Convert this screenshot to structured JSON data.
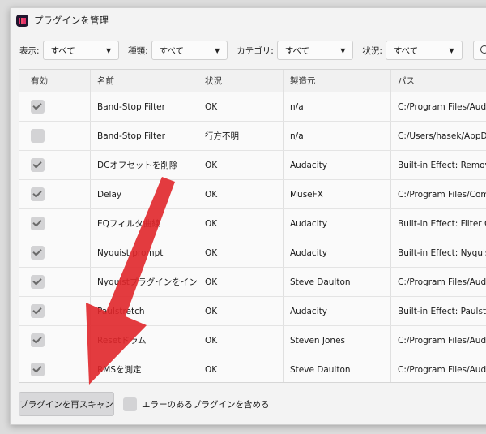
{
  "window": {
    "title": "プラグインを管理"
  },
  "filters": [
    {
      "label": "表示:",
      "value": "すべて"
    },
    {
      "label": "種類:",
      "value": "すべて"
    },
    {
      "label": "カテゴリ:",
      "value": "すべて"
    },
    {
      "label": "状況:",
      "value": "すべて"
    }
  ],
  "table": {
    "headers": [
      "有効",
      "名前",
      "状況",
      "製造元",
      "パス"
    ],
    "rows": [
      {
        "enabled": true,
        "name": "Band-Stop Filter",
        "status": "OK",
        "vendor": "n/a",
        "path": "C:/Program Files/Audac"
      },
      {
        "enabled": false,
        "name": "Band-Stop Filter",
        "status": "行方不明",
        "vendor": "n/a",
        "path": "C:/Users/hasek/AppData"
      },
      {
        "enabled": true,
        "name": "DCオフセットを削除",
        "status": "OK",
        "vendor": "Audacity",
        "path": "Built-in Effect: Remove I"
      },
      {
        "enabled": true,
        "name": "Delay",
        "status": "OK",
        "vendor": "MuseFX",
        "path": "C:/Program Files/Comm"
      },
      {
        "enabled": true,
        "name": "EQフィルタ曲線",
        "status": "OK",
        "vendor": "Audacity",
        "path": "Built-in Effect: Filter Cur"
      },
      {
        "enabled": true,
        "name": "Nyquist prompt",
        "status": "OK",
        "vendor": "Audacity",
        "path": "Built-in Effect: Nyquist p"
      },
      {
        "enabled": true,
        "name": "Nyquistプラグインをインス...",
        "status": "OK",
        "vendor": "Steve Daulton",
        "path": "C:/Program Files/Audac"
      },
      {
        "enabled": true,
        "name": "Paulstretch",
        "status": "OK",
        "vendor": "Audacity",
        "path": "Built-in Effect: Paulstretc"
      },
      {
        "enabled": true,
        "name": "Resetドラム",
        "status": "OK",
        "vendor": "Steven Jones",
        "path": "C:/Program Files/Audac"
      },
      {
        "enabled": true,
        "name": "RMSを測定",
        "status": "OK",
        "vendor": "Steve Daulton",
        "path": "C:/Program Files/Audac"
      }
    ]
  },
  "footer": {
    "rescan_label": "プラグインを再スキャン",
    "include_errors_label": "エラーのあるプラグインを含める"
  },
  "colors": {
    "annotation_arrow": "#e0262a"
  }
}
